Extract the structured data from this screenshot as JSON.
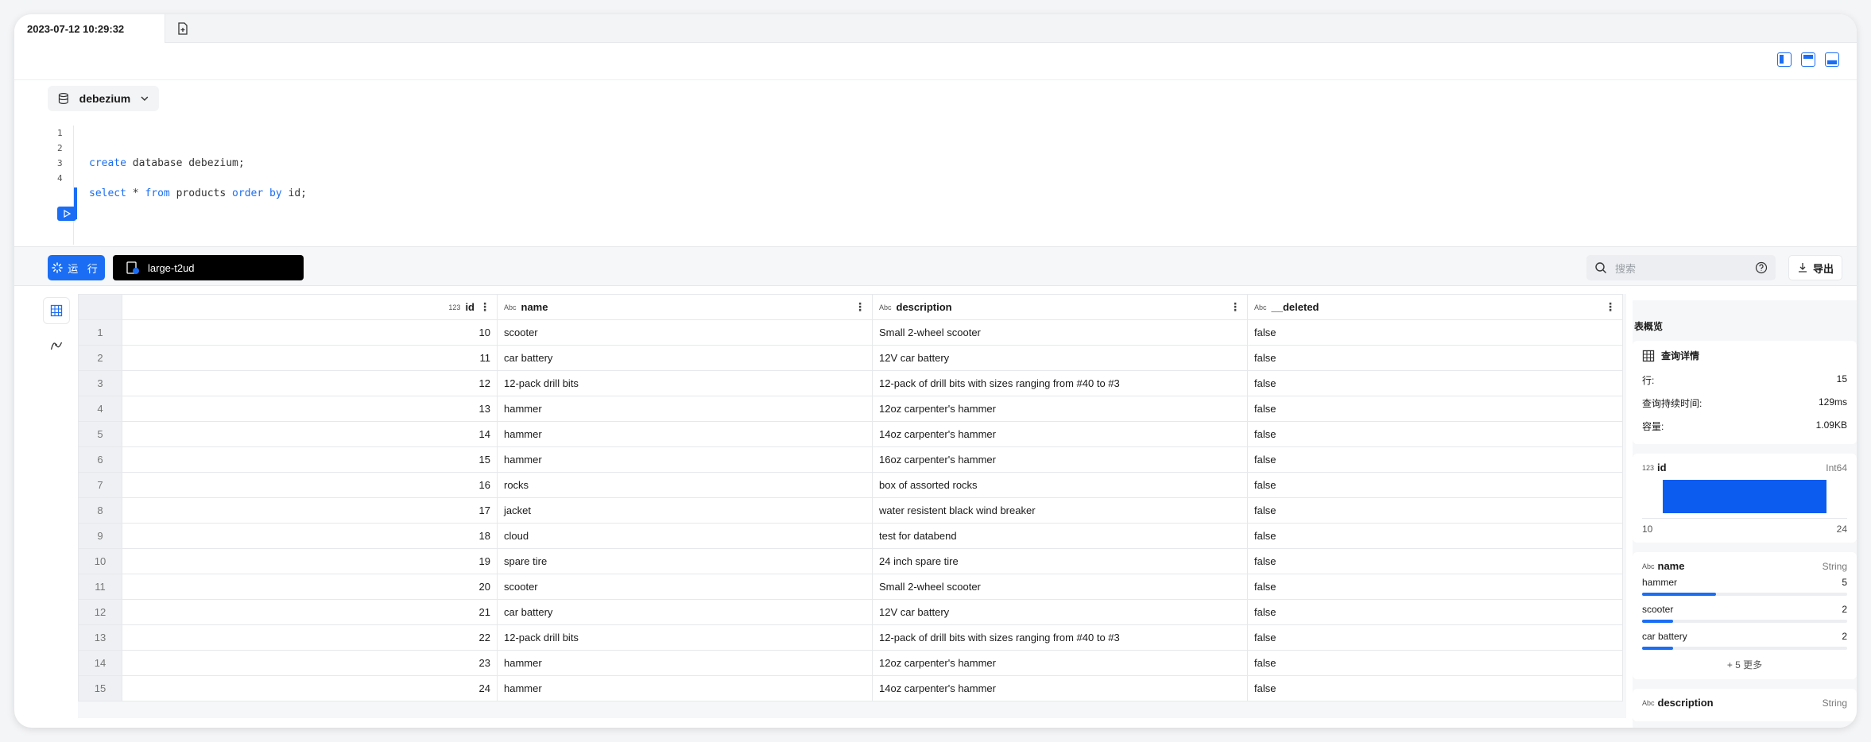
{
  "tab": {
    "title": "2023-07-12 10:29:32"
  },
  "database": {
    "name": "debezium"
  },
  "editor": {
    "line_numbers": [
      "1",
      "2",
      "3",
      "4"
    ],
    "line3": {
      "kw": "create",
      "rest": " database debezium;"
    },
    "line5": {
      "kw1": "select",
      "mid1": " * ",
      "kw2": "from",
      "mid2": " products ",
      "kw3": "order by",
      "end": " id;"
    }
  },
  "actions": {
    "run_label": "运 行",
    "warehouse": "large-t2ud",
    "search_placeholder": "搜索",
    "export_label": "导出"
  },
  "table": {
    "columns": [
      {
        "type": "123",
        "name": "id"
      },
      {
        "type": "Abc",
        "name": "name"
      },
      {
        "type": "Abc",
        "name": "description"
      },
      {
        "type": "Abc",
        "name": "__deleted"
      }
    ],
    "rows": [
      [
        "1",
        "10",
        "scooter",
        "Small 2-wheel scooter",
        "false"
      ],
      [
        "2",
        "11",
        "car battery",
        "12V car battery",
        "false"
      ],
      [
        "3",
        "12",
        "12-pack drill bits",
        "12-pack of drill bits with sizes ranging from #40 to #3",
        "false"
      ],
      [
        "4",
        "13",
        "hammer",
        "12oz carpenter's hammer",
        "false"
      ],
      [
        "5",
        "14",
        "hammer",
        "14oz carpenter's hammer",
        "false"
      ],
      [
        "6",
        "15",
        "hammer",
        "16oz carpenter's hammer",
        "false"
      ],
      [
        "7",
        "16",
        "rocks",
        "box of assorted rocks",
        "false"
      ],
      [
        "8",
        "17",
        "jacket",
        "water resistent black wind breaker",
        "false"
      ],
      [
        "9",
        "18",
        "cloud",
        "test for databend",
        "false"
      ],
      [
        "10",
        "19",
        "spare tire",
        "24 inch spare tire",
        "false"
      ],
      [
        "11",
        "20",
        "scooter",
        "Small 2-wheel scooter",
        "false"
      ],
      [
        "12",
        "21",
        "car battery",
        "12V car battery",
        "false"
      ],
      [
        "13",
        "22",
        "12-pack drill bits",
        "12-pack of drill bits with sizes ranging from #40 to #3",
        "false"
      ],
      [
        "14",
        "23",
        "hammer",
        "12oz carpenter's hammer",
        "false"
      ],
      [
        "15",
        "24",
        "hammer",
        "14oz carpenter's hammer",
        "false"
      ]
    ]
  },
  "summary": {
    "title": "表概览",
    "details_title": "查询详情",
    "rows_label": "行:",
    "rows_value": "15",
    "duration_label": "查询持续时间:",
    "duration_value": "129ms",
    "size_label": "容量:",
    "size_value": "1.09KB",
    "id_col": {
      "type": "123",
      "name": "id",
      "dtype": "Int64",
      "min": "10",
      "max": "24"
    },
    "name_col": {
      "type": "Abc",
      "name": "name",
      "dtype": "String",
      "items": [
        {
          "label": "hammer",
          "count": "5",
          "fraction": 0.36
        },
        {
          "label": "scooter",
          "count": "2",
          "fraction": 0.15
        },
        {
          "label": "car battery",
          "count": "2",
          "fraction": 0.15
        }
      ],
      "more": "+ 5 更多"
    },
    "desc_col": {
      "type": "Abc",
      "name": "description",
      "dtype": "String"
    }
  }
}
